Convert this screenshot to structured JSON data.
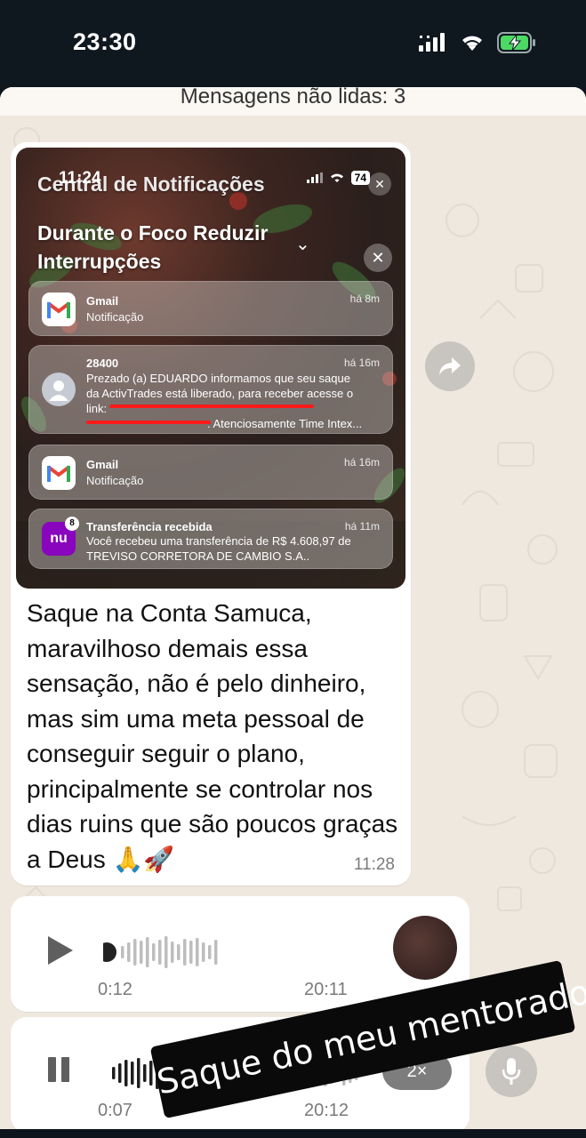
{
  "status_bar": {
    "time": "23:30"
  },
  "chat": {
    "unread_banner": "Mensagens não lidas: 3",
    "message": {
      "screenshot": {
        "nc_time": "11:24",
        "nc_title": "Central de Notificações",
        "battery": "74",
        "focus_title": "Durante o Foco Reduzir Interrupções",
        "notifications": [
          {
            "app": "Gmail",
            "sub": "Notificação",
            "time": "há 8m"
          },
          {
            "app": "28400",
            "time": "há 16m",
            "body1": "Prezado (a) EDUARDO informamos que seu saque",
            "body2": "da ActivTrades está liberado, para receber acesse o",
            "body3": "link:",
            "body4": ". Atenciosamente Time Intex..."
          },
          {
            "app": "Gmail",
            "sub": "Notificação",
            "time": "há 16m"
          },
          {
            "app": "Transferência recebida",
            "time": "há 11m",
            "body1": "Você recebeu uma transferência de R$ 4.608,97 de",
            "body2": "TREVISO CORRETORA DE CAMBIO S.A..",
            "badge": "8",
            "icon_text": "nu"
          }
        ]
      },
      "caption": "Saque na Conta Samuca, maravilhoso demais essa sensação, não é pelo dinheiro, mas sim uma meta pessoal de conseguir seguir o plano, principalmente se controlar nos dias ruins que são poucos graças a Deus 🙏🚀",
      "time": "11:28"
    },
    "voice_messages": [
      {
        "duration": "0:12",
        "time": "20:11",
        "state": "paused",
        "progress": 0.0
      },
      {
        "duration": "0:07",
        "time": "20:12",
        "state": "playing",
        "progress": 0.3,
        "speed": "2×"
      }
    ],
    "overlay_text": "Saque do meu mentorado"
  },
  "icons": {
    "forward": "forward-icon",
    "mic": "microphone-icon"
  }
}
